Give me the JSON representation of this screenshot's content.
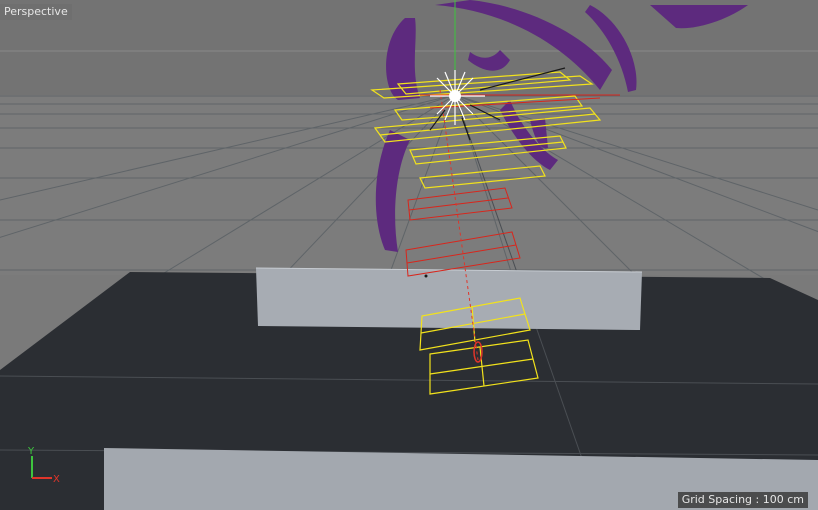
{
  "viewport": {
    "view_name": "Perspective",
    "grid_spacing_label": "Grid Spacing : 100 cm"
  },
  "axis_gizmo": {
    "y_label": "Y",
    "x_label": "X"
  },
  "colors": {
    "background": "#7a7a7a",
    "floor_dark": "#2b2e33",
    "box_light": "#a7acb3",
    "grid_line": "#5f6468",
    "purple_mesh": "#5d2a7e",
    "yellow_wire": "#f2e21c",
    "red_wire": "#d8261c",
    "green_axis": "#3ec43e",
    "red_axis": "#e0352a"
  }
}
